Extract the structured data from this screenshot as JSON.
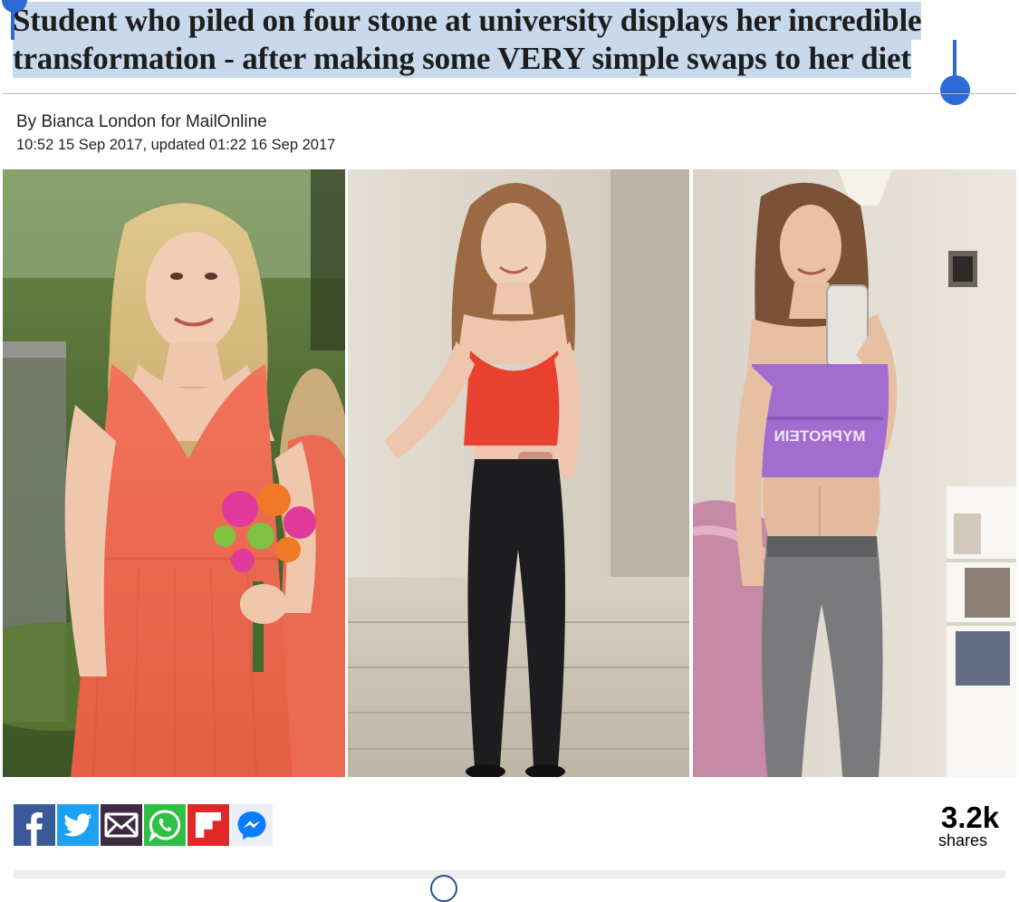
{
  "article": {
    "headline": "Student who piled on four stone at university displays her incredible transformation - after making some VERY simple swaps to her diet",
    "byline": "By Bianca London for MailOnline",
    "timestamp": "10:52 15 Sep 2017, updated 01:22 16 Sep 2017"
  },
  "photo_strip": {
    "photo_3_shirt_text": "MYPROTEIN"
  },
  "share_bar": {
    "buttons": [
      {
        "network": "Facebook",
        "icon": "facebook-icon",
        "color": "#3b5998"
      },
      {
        "network": "Twitter",
        "icon": "twitter-icon",
        "color": "#1da1f2"
      },
      {
        "network": "Email",
        "icon": "envelope-icon",
        "color": "#3f2a44"
      },
      {
        "network": "WhatsApp",
        "icon": "whatsapp-icon",
        "color": "#2ec043"
      },
      {
        "network": "Flipboard",
        "icon": "flipboard-icon",
        "color": "#e12828"
      },
      {
        "network": "Messenger",
        "icon": "messenger-icon",
        "color": "#0084ff"
      }
    ],
    "count": "3.2k",
    "count_label": "shares"
  },
  "colors": {
    "selection_highlight": "#c9d9ec",
    "selection_handle": "#2c6bd6"
  }
}
